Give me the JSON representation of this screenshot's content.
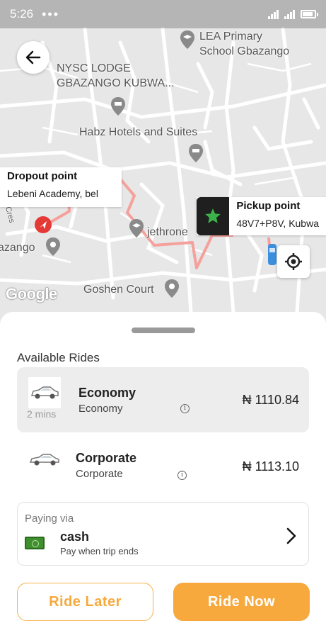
{
  "status_bar": {
    "time": "5:26",
    "dots": "•••"
  },
  "map": {
    "labels": {
      "school": "LEA Primary\nSchool Gbazango",
      "lodge": "NYSC LODGE\nGBAZANGO KUBWA...",
      "hotel": "Habz Hotels and Suites",
      "jethrone": "jethrone",
      "gbazango": "azango",
      "cres": "Cres",
      "goshen": "Goshen Court"
    },
    "dropout": {
      "title": "Dropout point",
      "subtitle": "Lebeni Academy, bel"
    },
    "pickup": {
      "title": "Pickup point",
      "subtitle": "48V7+P8V, Kubwa"
    },
    "attribution": "Google",
    "route_color": "#f4a19c"
  },
  "sheet": {
    "title": "Available Rides",
    "rides": [
      {
        "name": "Economy",
        "subtitle": "Economy",
        "eta": "2 mins",
        "price": "₦ 1110.84",
        "info": "i"
      },
      {
        "name": "Corporate",
        "subtitle": "Corporate",
        "eta": "",
        "price": "₦ 1113.10",
        "info": "i"
      }
    ],
    "payment": {
      "label": "Paying via",
      "method": "cash",
      "description": "Pay when trip ends"
    },
    "buttons": {
      "later": "Ride Later",
      "now": "Ride Now"
    }
  },
  "colors": {
    "accent": "#f7a93e",
    "pickup_star": "#3cb34a",
    "dropout_marker": "#e53935"
  }
}
